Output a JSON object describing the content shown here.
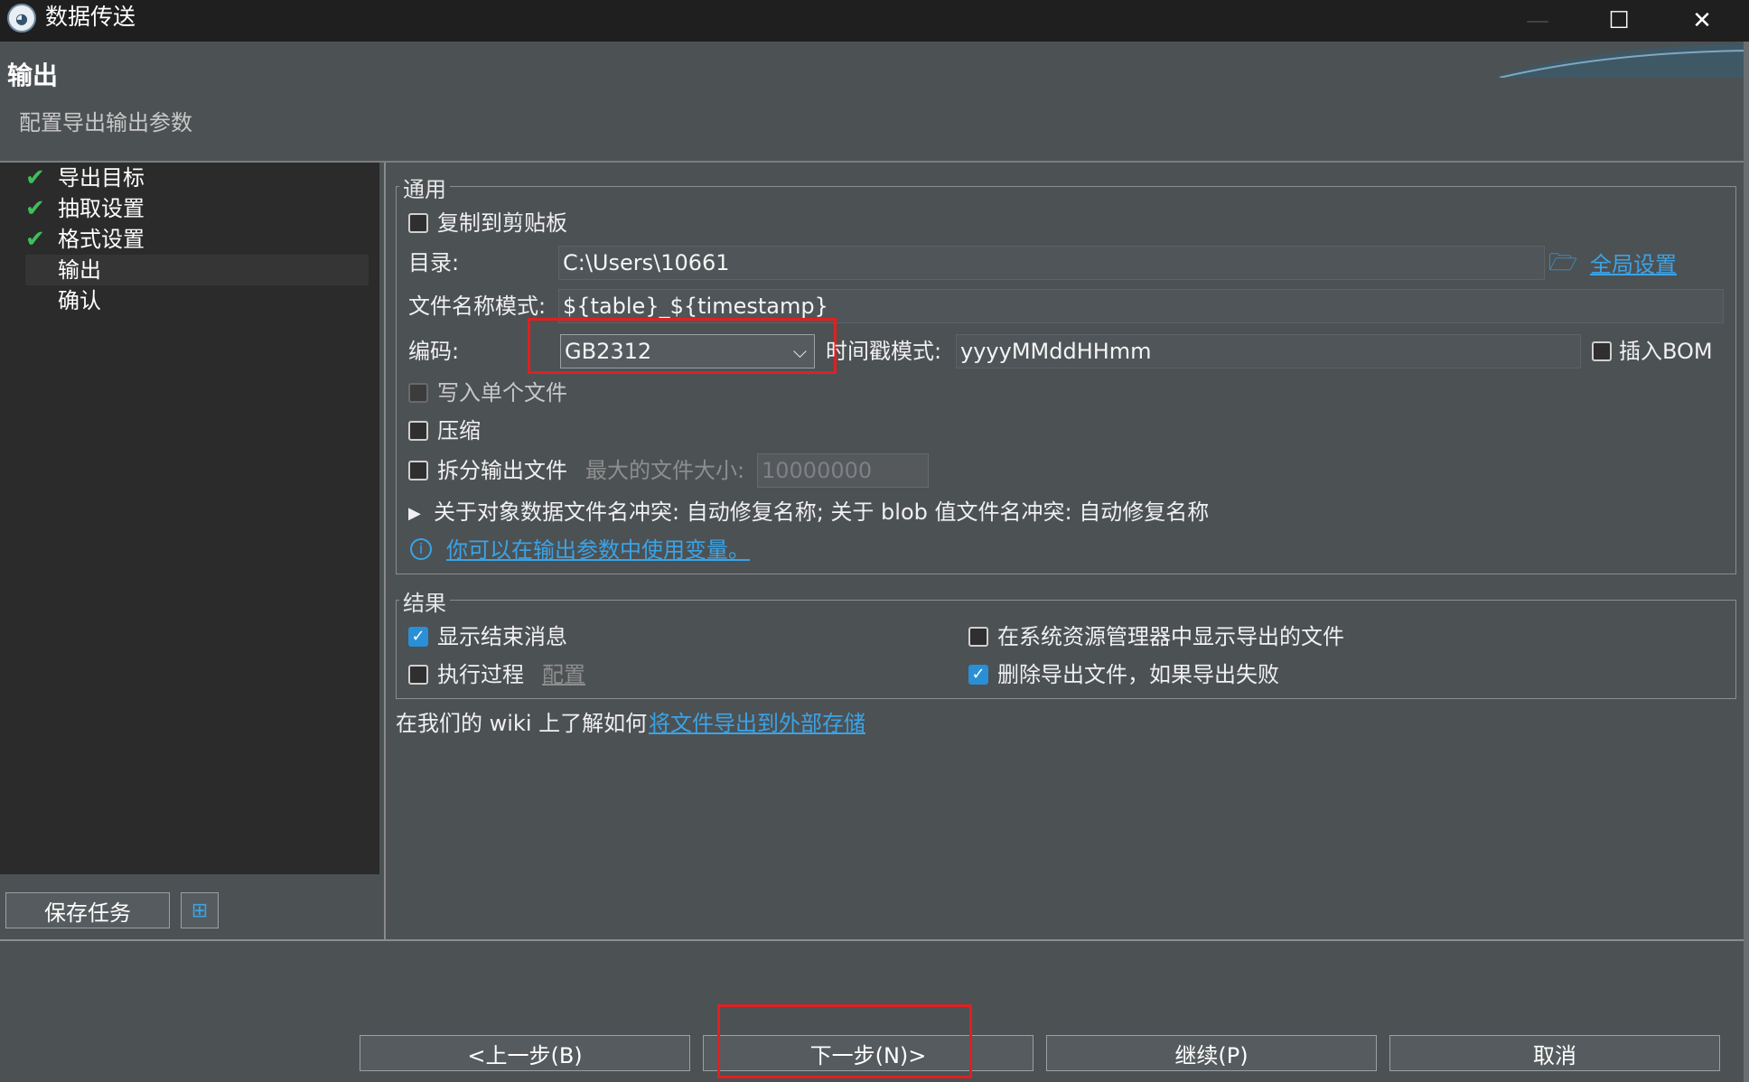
{
  "window": {
    "title": "数据传送",
    "minimize": "—",
    "maximize": "☐",
    "close": "✕"
  },
  "header": {
    "title": "输出",
    "subtitle": "配置导出输出参数"
  },
  "nav": {
    "items": [
      {
        "label": "导出目标",
        "done": true
      },
      {
        "label": "抽取设置",
        "done": true
      },
      {
        "label": "格式设置",
        "done": true
      },
      {
        "label": "输出",
        "done": false,
        "active": true
      },
      {
        "label": "确认",
        "done": false
      }
    ],
    "check_glyph": "✔"
  },
  "general": {
    "legend": "通用",
    "copy_clipboard": "复制到剪贴板",
    "directory_label": "目录:",
    "directory_value": "C:\\Users\\10661",
    "global_settings": "全局设置",
    "filename_label": "文件名称模式:",
    "filename_value": "${table}_${timestamp}",
    "encoding_label": "编码:",
    "encoding_value": "GB2312",
    "timestamp_label": "时间戳模式:",
    "timestamp_value": "yyyyMMddHHmm",
    "insert_bom": "插入BOM",
    "single_file": "写入单个文件",
    "compress": "压缩",
    "split_output": "拆分输出文件",
    "max_size_label": "最大的文件大小:",
    "max_size_value": "10000000",
    "conflict_text": "关于对象数据文件名冲突: 自动修复名称; 关于 blob 值文件名冲突: 自动修复名称",
    "variables_link": "你可以在输出参数中使用变量。"
  },
  "results": {
    "legend": "结果",
    "show_finish": "显示结束消息",
    "show_in_explorer": "在系统资源管理器中显示导出的文件",
    "exec_process": "执行过程",
    "configure": "配置",
    "delete_on_fail": "删除导出文件，如果导出失败",
    "checked": {
      "show_finish": true,
      "show_in_explorer": false,
      "exec_process": false,
      "delete_on_fail": true
    }
  },
  "wiki": {
    "text": "在我们的 wiki 上了解如何",
    "link": "将文件导出到外部存储"
  },
  "sidebar_bottom": {
    "save_task": "保存任务"
  },
  "footer": {
    "prev": "<上一步(B)",
    "next": "下一步(N)>",
    "continue": "继续(P)",
    "cancel": "取消"
  }
}
